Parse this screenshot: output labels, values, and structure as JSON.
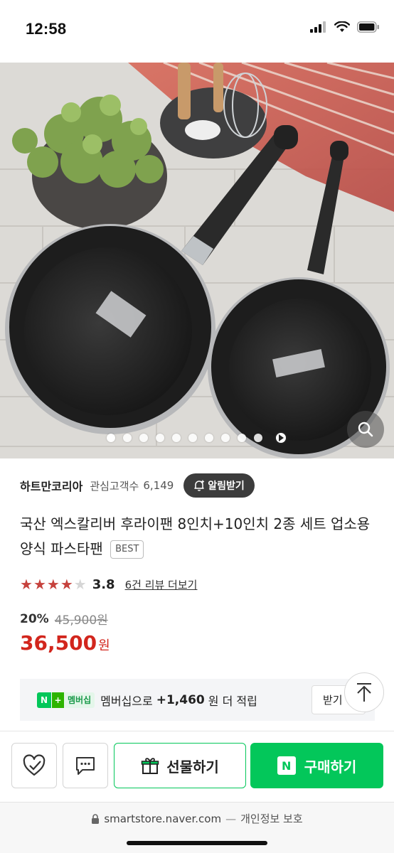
{
  "status_bar": {
    "time": "12:58"
  },
  "gallery": {
    "dot_count": 10,
    "active_index": 0
  },
  "store": {
    "name": "하트만코리아",
    "interest_label": "관심고객수",
    "interest_count": "6,149",
    "alarm_label": "알림받기"
  },
  "product": {
    "title": "국산 엑스칼리버 후라이팬 8인치+10인치 2종 세트 업소용 양식 파스타팬",
    "badge": "BEST",
    "rating": "3.8",
    "stars_filled": 4,
    "review_link": "6건 리뷰 더보기",
    "discount": "20%",
    "original_price": "45,900원",
    "price": "36,500",
    "price_unit": "원"
  },
  "membership": {
    "badge_n": "N",
    "badge_plus": "+",
    "badge_text": "멤버십",
    "text": "멤버십으로",
    "points": "+1,460",
    "tail": "원 더 적립",
    "button": "받기"
  },
  "actions": {
    "gift_label": "선물하기",
    "buy_badge": "N",
    "buy_label": "구매하기"
  },
  "browser": {
    "domain": "smartstore.naver.com",
    "separator": "—",
    "privacy": "개인정보 보호"
  },
  "colors": {
    "naver_green": "#03c75a",
    "price_red": "#d2261d",
    "star_red": "#c6423d"
  }
}
